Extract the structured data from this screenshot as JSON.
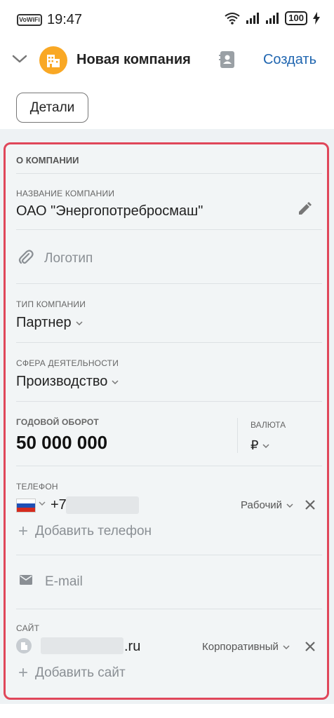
{
  "status": {
    "volte": "VoWiFi",
    "time": "19:47",
    "battery": "100"
  },
  "header": {
    "title": "Новая компания",
    "create_label": "Создать",
    "details_label": "Детали"
  },
  "section": {
    "title": "О КОМПАНИИ"
  },
  "company_name": {
    "label": "НАЗВАНИЕ КОМПАНИИ",
    "value": "ОАО \"Энергопотребросмаш\""
  },
  "logo": {
    "placeholder": "Логотип"
  },
  "company_type": {
    "label": "ТИП КОМПАНИИ",
    "value": "Партнер"
  },
  "industry": {
    "label": "СФЕРА ДЕЯТЕЛЬНОСТИ",
    "value": "Производство"
  },
  "revenue": {
    "label": "ГОДОВОЙ ОБОРОТ",
    "value": "50 000 000",
    "currency_label": "ВАЛЮТА",
    "currency_value": "₽"
  },
  "phone": {
    "label": "ТЕЛЕФОН",
    "prefix": "+7",
    "type": "Рабочий",
    "add_label": "Добавить телефон"
  },
  "email": {
    "placeholder": "E-mail"
  },
  "site": {
    "label": "САЙТ",
    "suffix": ".ru",
    "type": "Корпоративный",
    "add_label": "Добавить сайт"
  },
  "colors": {
    "accent": "#2066b0",
    "highlight_border": "#e0475a",
    "avatar": "#f9a825"
  },
  "icons": [
    "chevron-down-icon",
    "building-icon",
    "contacts-book-icon",
    "pencil-icon",
    "paperclip-icon",
    "mail-icon",
    "close-icon",
    "globe-icon",
    "plus-icon"
  ]
}
